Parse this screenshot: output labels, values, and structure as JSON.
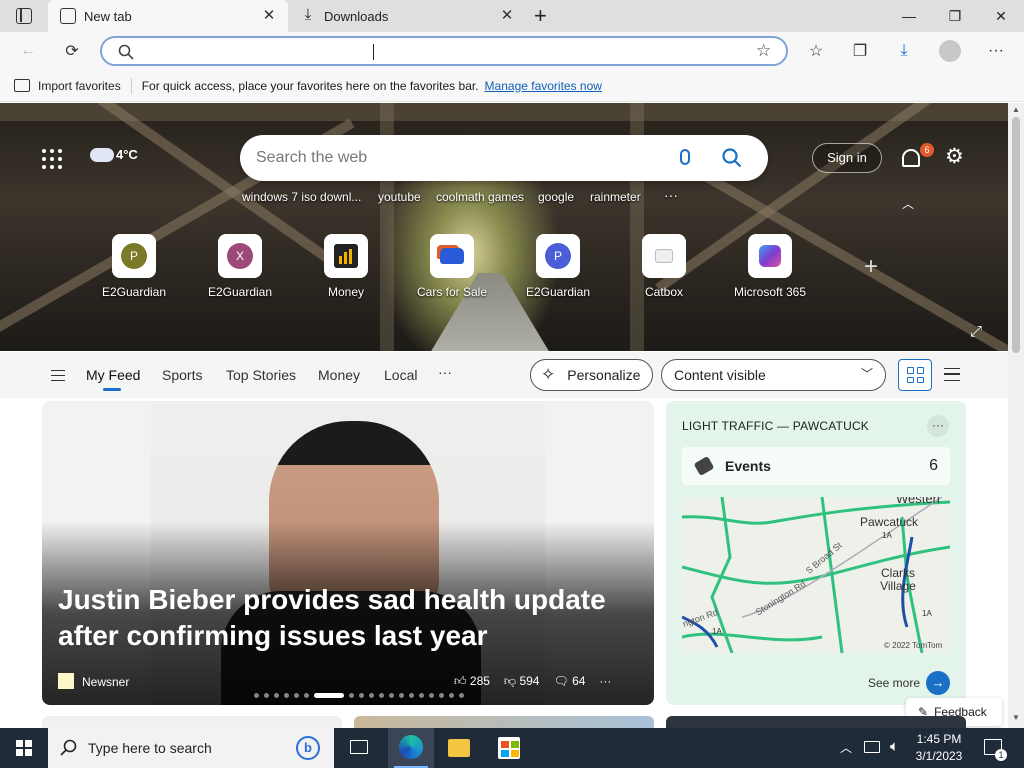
{
  "tabs": [
    {
      "label": "New tab",
      "active": true,
      "icon": "newtab-icon"
    },
    {
      "label": "Downloads",
      "active": false,
      "icon": "download-icon"
    }
  ],
  "window": {
    "minimize": "—",
    "restore": "❐",
    "close": "✕"
  },
  "favorites_bar": {
    "import_label": "Import favorites",
    "message": "For quick access, place your favorites here on the favorites bar.",
    "manage_link": "Manage favorites now"
  },
  "hero": {
    "weather": "4°C",
    "search_placeholder": "Search the web",
    "sign_in": "Sign in",
    "notifications_count": "6",
    "trending": [
      "windows 7 iso downl...",
      "youtube",
      "coolmath games",
      "google",
      "rainmeter"
    ],
    "more": "···",
    "quick_links": [
      {
        "label": "E2Guardian",
        "letter": "P",
        "color": "#7a7a2a"
      },
      {
        "label": "E2Guardian",
        "letter": "X",
        "color": "#9b4a7a"
      },
      {
        "label": "Money",
        "letter": "",
        "color": "#222"
      },
      {
        "label": "Cars for Sale",
        "letter": "",
        "color": "#2a5bd7"
      },
      {
        "label": "E2Guardian",
        "letter": "P",
        "color": "#4a5fd6"
      },
      {
        "label": "Catbox",
        "letter": "",
        "color": "#ccc"
      },
      {
        "label": "Microsoft 365",
        "letter": "",
        "color": "#5a4ed1"
      }
    ],
    "add_label": "+"
  },
  "feed_nav": {
    "tabs": [
      "My Feed",
      "Sports",
      "Top Stories",
      "Money",
      "Local"
    ],
    "more": "···",
    "personalize": "Personalize",
    "content_select": "Content visible"
  },
  "main_story": {
    "headline": "Justin Bieber provides sad health update after confirming issues last year",
    "source": "Newsner",
    "likes": "285",
    "dislikes": "594",
    "comments": "64",
    "more": "···",
    "carousel_total": 19,
    "carousel_active": 6
  },
  "traffic": {
    "title": "LIGHT TRAFFIC — PAWCATUCK",
    "events_label": "Events",
    "events_count": "6",
    "map_labels": [
      "Pawcatuck",
      "Clarks Village",
      "Westerl",
      "Stonington Rd",
      "S Broad St",
      "1A",
      "1A",
      "1A",
      "ngton Rd"
    ],
    "copyright": "© 2022 TomTom",
    "see_more": "See more",
    "more": "···"
  },
  "feedback": "Feedback",
  "taskbar": {
    "search_placeholder": "Type here to search",
    "time": "1:45 PM",
    "date": "3/1/2023",
    "notification_count": "1"
  }
}
